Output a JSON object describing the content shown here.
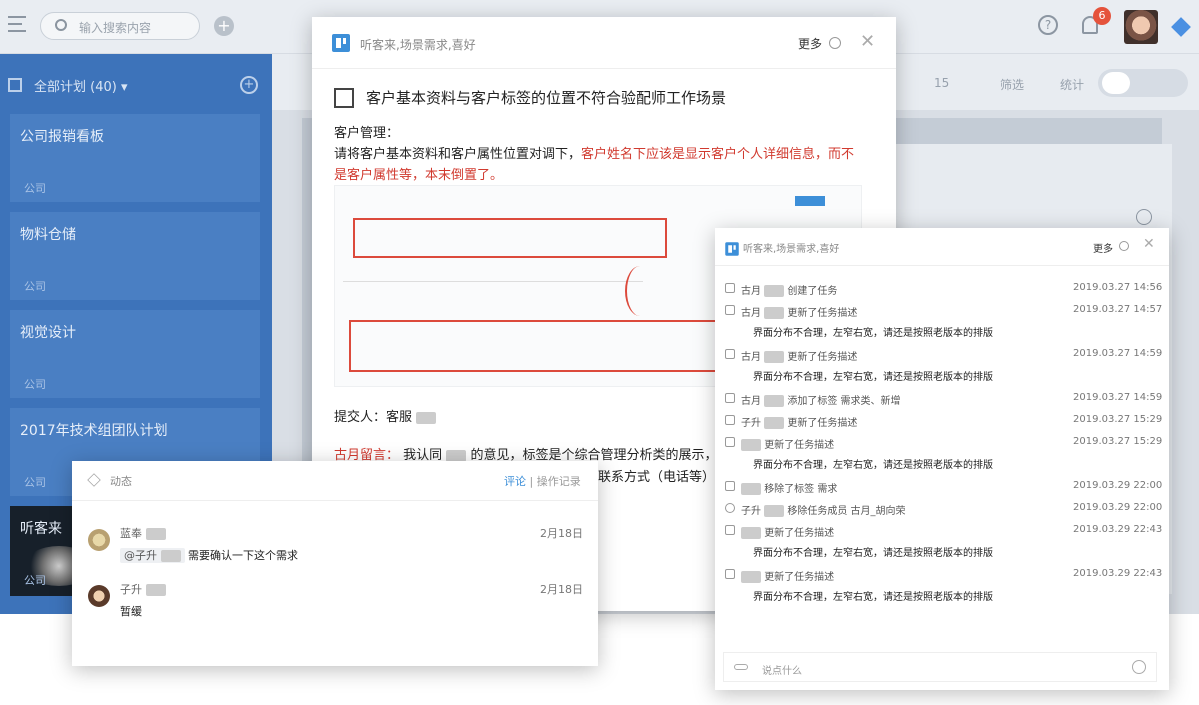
{
  "topbar": {
    "search_placeholder": "输入搜索内容",
    "badge_count": "6"
  },
  "sidebar": {
    "header": "全部计划 (40)",
    "boards": [
      {
        "title": "公司报销看板",
        "sub": "公司"
      },
      {
        "title": "物料仓储",
        "sub": "公司"
      },
      {
        "title": "视觉设计",
        "sub": "公司"
      },
      {
        "title": "2017年技术组团队计划",
        "sub": "公司"
      },
      {
        "title": "听客来",
        "sub": "公司"
      }
    ]
  },
  "toolbar": {
    "members": "15",
    "filter": "筛选",
    "stats": "统计"
  },
  "task": {
    "project": "听客来,场景需求,喜好",
    "more": "更多",
    "title": "客户基本资料与客户标签的位置不符合验配师工作场景",
    "body_line1": "客户管理：",
    "body_line2_a": "请将客户基本资料和客户属性位置对调下，",
    "body_line2_b": "客户姓名下应该是显示客户个人详细信息，而不",
    "body_line3": "是客户属性等，本末倒置了。",
    "submitter": "提交人：客服",
    "msg_label": "古月留言：",
    "msg_line1": "我认同",
    "msg_line1b": "的意见，标签是个综合管理分析类的展示，",
    "msg_line2": "联系方式（电话等）"
  },
  "activity": {
    "project": "听客来,场景需求,喜好",
    "more": "更多",
    "input_placeholder": "说点什么",
    "rows": [
      {
        "user": "古月",
        "action": "创建了任务",
        "time": "2019.03.27 14:56",
        "desc": ""
      },
      {
        "user": "古月",
        "action": "更新了任务描述",
        "time": "2019.03.27 14:57",
        "desc": "界面分布不合理，左窄右宽，请还是按照老版本的排版"
      },
      {
        "user": "古月",
        "action": "更新了任务描述",
        "time": "2019.03.27 14:59",
        "desc": "界面分布不合理，左窄右宽，请还是按照老版本的排版"
      },
      {
        "user": "古月",
        "action": "添加了标签 需求类、新增",
        "time": "2019.03.27 14:59",
        "desc": ""
      },
      {
        "user": "子升",
        "action": "更新了任务描述",
        "time": "2019.03.27 15:29",
        "desc": ""
      },
      {
        "user": "",
        "action": "更新了任务描述",
        "time": "2019.03.27 15:29",
        "desc": "界面分布不合理，左窄右宽，请还是按照老版本的排版"
      },
      {
        "user": "",
        "action": "移除了标签 需求",
        "time": "2019.03.29 22:00",
        "desc": ""
      },
      {
        "user": "子升",
        "action": "移除任务成员 古月_胡向荣",
        "time": "2019.03.29 22:00",
        "desc": ""
      },
      {
        "user": "",
        "action": "更新了任务描述",
        "time": "2019.03.29 22:43",
        "desc": "界面分布不合理，左窄右宽，请还是按照老版本的排版"
      },
      {
        "user": "",
        "action": "更新了任务描述",
        "time": "2019.03.29 22:43",
        "desc": "界面分布不合理，左窄右宽，请还是按照老版本的排版"
      }
    ]
  },
  "dynamic": {
    "title": "动态",
    "tab_comment": "评论",
    "tab_sep": "|",
    "tab_log": "操作记录",
    "items": [
      {
        "name": "蓝奉",
        "date": "2月18日",
        "mention": "@子升",
        "body": "需要确认一下这个需求"
      },
      {
        "name": "子升",
        "date": "2月18日",
        "mention": "",
        "body": "暂缓"
      }
    ]
  }
}
